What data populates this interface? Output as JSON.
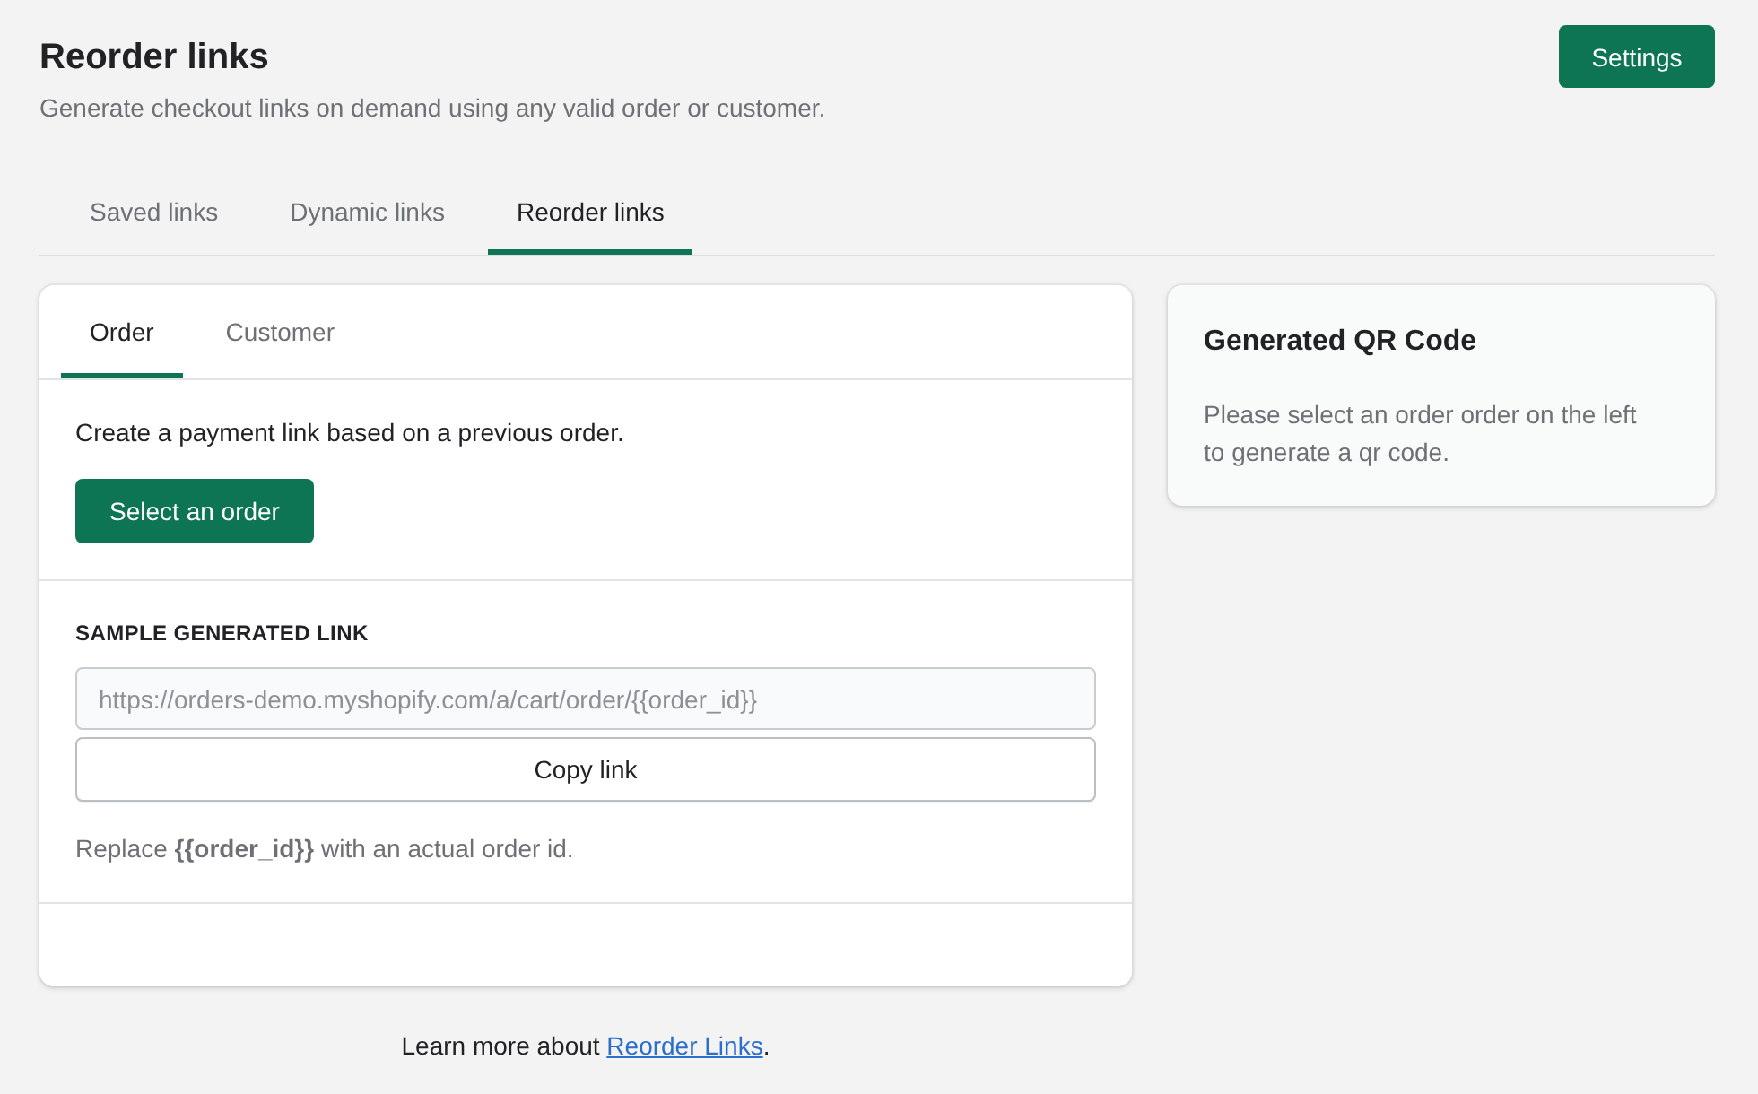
{
  "header": {
    "title": "Reorder links",
    "subtitle": "Generate checkout links on demand using any valid order or customer.",
    "settings_button": "Settings"
  },
  "tabs": [
    {
      "label": "Saved links",
      "selected": false
    },
    {
      "label": "Dynamic links",
      "selected": false
    },
    {
      "label": "Reorder links",
      "selected": true
    }
  ],
  "link_card": {
    "tabs": [
      {
        "label": "Order",
        "selected": true
      },
      {
        "label": "Customer",
        "selected": false
      }
    ],
    "description": "Create a payment link based on a previous order.",
    "select_button": "Select an order",
    "section_title": "SAMPLE GENERATED LINK",
    "link_field": {
      "value": "https://orders-demo.myshopify.com/a/cart/order/{{order_id}}",
      "disabled": true
    },
    "copy_button": "Copy link",
    "hint": "Replace **{{order_id}}** with an actual order id."
  },
  "qr_card": {
    "title": "Generated QR Code",
    "message": "Please select an order order on the left to generate a qr code."
  },
  "footer": {
    "text": "Learn more about ",
    "link": "Reorder Links",
    "end": "."
  }
}
